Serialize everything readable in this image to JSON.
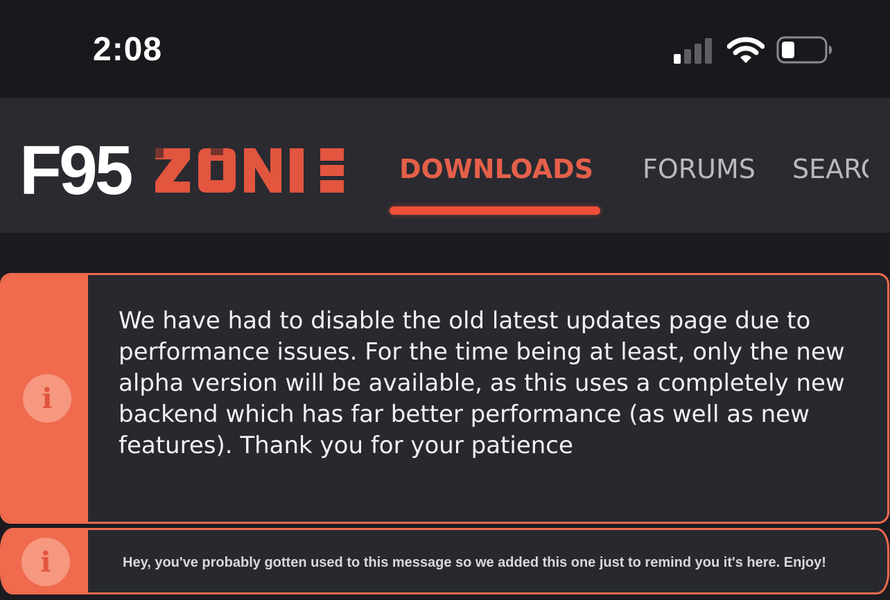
{
  "status_bar": {
    "time": "2:08",
    "icons": [
      "signal-icon",
      "wifi-icon",
      "battery-icon"
    ],
    "battery_level": 0.25
  },
  "navbar": {
    "logo_text": "F95ZONE",
    "tabs": [
      {
        "label": "DOWNLOADS",
        "active": true
      },
      {
        "label": "FORUMS",
        "active": false
      },
      {
        "label": "SEARCH",
        "active": false
      }
    ]
  },
  "notices": [
    {
      "icon": "info-icon",
      "text": "We have had to disable the old latest updates page due to performance issues. For the time being at least, only the new alpha version will be available, as this uses a completely new backend which has far better performance (as well as new features). Thank you for your patience"
    },
    {
      "icon": "info-icon",
      "text": "Hey, you've probably gotten used to this message so we added this one just to remind you it's here. Enjoy!"
    }
  ],
  "colors": {
    "accent": "#f06a4e",
    "background": "#1b1b20",
    "navbar": "#2a2a30"
  }
}
